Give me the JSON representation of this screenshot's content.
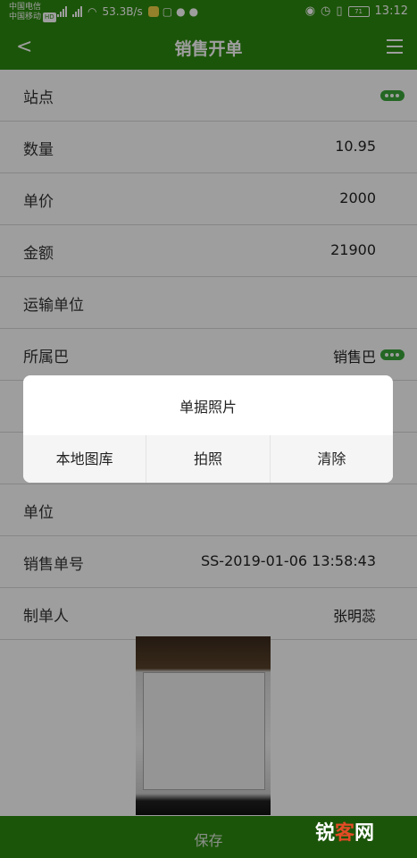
{
  "status_bar": {
    "carrier1": "中国电信",
    "carrier2": "中国移动",
    "hd": "HD",
    "net_speed": "53.3B/s",
    "battery": "71",
    "time": "13:12"
  },
  "navbar": {
    "title": "销售开单"
  },
  "form": {
    "rows": [
      {
        "label": "站点",
        "value": ""
      },
      {
        "label": "数量",
        "value": "10.95"
      },
      {
        "label": "单价",
        "value": "2000"
      },
      {
        "label": "金额",
        "value": "21900"
      },
      {
        "label": "运输单位",
        "value": ""
      },
      {
        "label": "所属巴",
        "value": "销售巴"
      },
      {
        "label": "",
        "value": ""
      },
      {
        "label": "",
        "value": ""
      },
      {
        "label": "单位",
        "value": ""
      },
      {
        "label": "销售单号",
        "value": "SS-2019-01-06 13:58:43"
      },
      {
        "label": "制单人",
        "value": "张明蕊"
      }
    ]
  },
  "dialog": {
    "title": "单据照片",
    "actions": [
      "本地图库",
      "拍照",
      "清除"
    ]
  },
  "save_bar": {
    "label": "保存"
  },
  "watermark": {
    "text_main": "锐",
    "text_accent": "客",
    "text_end": "网"
  }
}
